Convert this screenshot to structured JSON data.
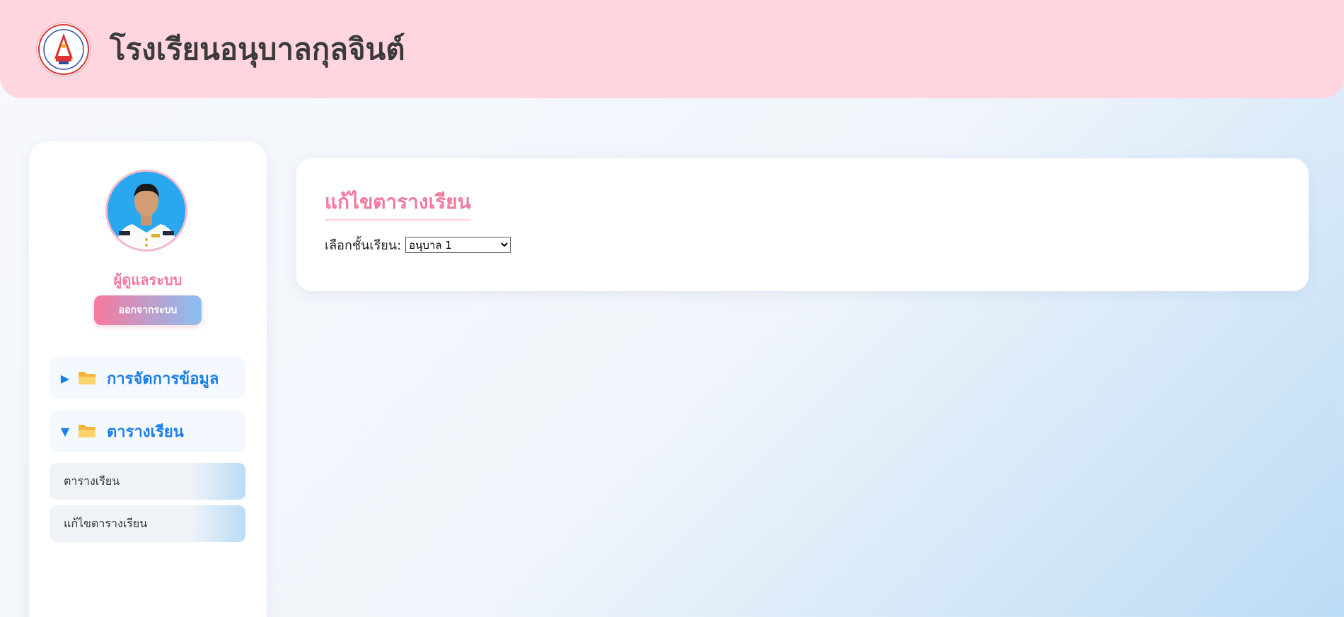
{
  "header": {
    "school_name": "โรงเรียนอนุบาลกุลจินต์"
  },
  "sidebar": {
    "role": "ผู้ดูแลระบบ",
    "logout_label": "ออกจากระบบ",
    "groups": [
      {
        "label": "การจัดการข้อมูล",
        "arrow": "▶",
        "expanded": false
      },
      {
        "label": "ตารางเรียน",
        "arrow": "▼",
        "expanded": true
      }
    ],
    "subitems": [
      {
        "label": "ตารางเรียน"
      },
      {
        "label": "แก้ไขตารางเรียน"
      }
    ]
  },
  "main": {
    "title": "แก้ไขตารางเรียน",
    "class_label": "เลือกชั้นเรียน:",
    "class_select": {
      "selected": "อนุบาล 1",
      "options": [
        "อนุบาล 1"
      ]
    }
  },
  "colors": {
    "header_bg": "#ffd6e0",
    "accent_pink": "#f37a9c",
    "accent_blue": "#1a7fe8"
  },
  "icons": {
    "logo": "school-seal",
    "folder": "folder-icon",
    "collapsed": "triangle-right-icon",
    "expanded": "triangle-down-icon"
  }
}
